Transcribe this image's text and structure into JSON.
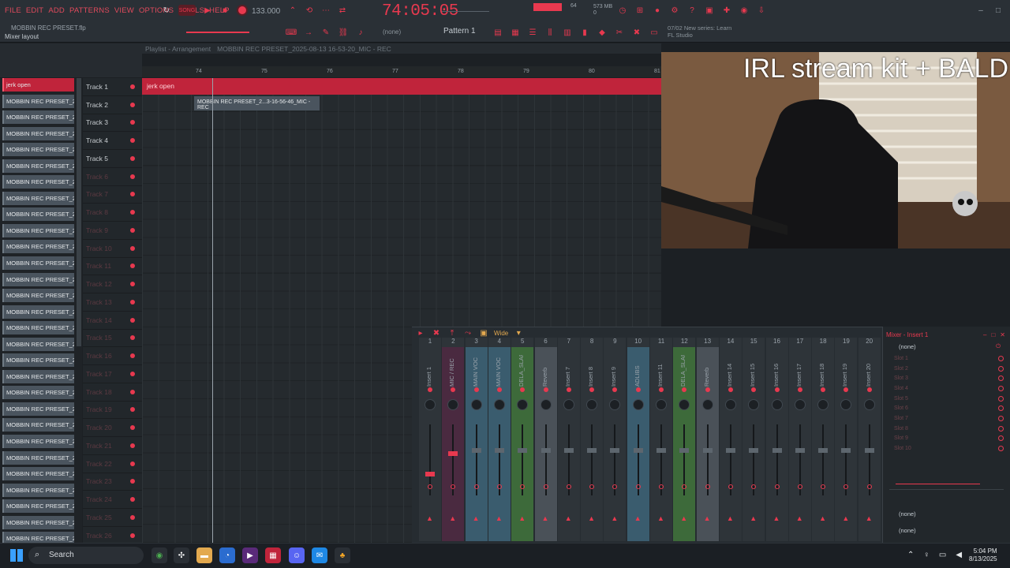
{
  "menu": [
    "FILE",
    "EDIT",
    "ADD",
    "PATTERNS",
    "VIEW",
    "OPTIONS",
    "TOOLS",
    "HELP"
  ],
  "transport": {
    "mode": "SONG",
    "tempo": "133.000",
    "time": "74:05:05",
    "meter_value": "64",
    "memory": "573 MB",
    "memory_sub": "0"
  },
  "project": {
    "file": "MOBBIN REC PRESET.flp",
    "hint": "Mixer layout",
    "pattern": "Pattern 1",
    "none_label": "(none)"
  },
  "news": {
    "date": "07/02",
    "text": "New series: Learn",
    "brand": "FL Studio"
  },
  "playlist": {
    "title": "Playlist - Arrangement",
    "path": "MOBBIN REC PRESET_2025-08-13 16-53-20_MIC - REC",
    "ruler": [
      "74",
      "75",
      "76",
      "77",
      "78",
      "79",
      "80",
      "81"
    ],
    "top_clip": "jerk open",
    "second_clip": "MOBBIN REC PRESET_2...3-16-56-46_MIC - REC",
    "left_clips": [
      "jerk open",
      "MOBBIN REC PRESET_202...",
      "MOBBIN REC PRESET_202...",
      "MOBBIN REC PRESET_202...",
      "MOBBIN REC PRESET_202...",
      "MOBBIN REC PRESET_202...",
      "MOBBIN REC PRESET_202...",
      "MOBBIN REC PRESET_202...",
      "MOBBIN REC PRESET_202...",
      "MOBBIN REC PRESET_202...",
      "MOBBIN REC PRESET_202...",
      "MOBBIN REC PRESET_202...",
      "MOBBIN REC PRESET_202...",
      "MOBBIN REC PRESET_202...",
      "MOBBIN REC PRESET_202...",
      "MOBBIN REC PRESET_202...",
      "MOBBIN REC PRESET_202...",
      "MOBBIN REC PRESET_202...",
      "MOBBIN REC PRESET_202...",
      "MOBBIN REC PRESET_202...",
      "MOBBIN REC PRESET_202...",
      "MOBBIN REC PRESET_202...",
      "MOBBIN REC PRESET_202...",
      "MOBBIN REC PRESET_202...",
      "MOBBIN REC PRESET_202...",
      "MOBBIN REC PRESET_202...",
      "MOBBIN REC PRESET_202...",
      "MOBBIN REC PRESET_202...",
      "MOBBIN REC PRESET_202..."
    ],
    "tracks": [
      "Track 1",
      "Track 2",
      "Track 3",
      "Track 4",
      "Track 5",
      "Track 6",
      "Track 7",
      "Track 8",
      "Track 9",
      "Track 10",
      "Track 11",
      "Track 12",
      "Track 13",
      "Track 14",
      "Track 15",
      "Track 16",
      "Track 17",
      "Track 18",
      "Track 19",
      "Track 20",
      "Track 21",
      "Track 22",
      "Track 23",
      "Track 24",
      "Track 25",
      "Track 26"
    ]
  },
  "webcam": {
    "overlay": "IRL stream kit + BALD"
  },
  "mixer": {
    "layout": "Wide",
    "strips": [
      {
        "num": "1",
        "name": "Insert 1",
        "color": "#2e3439"
      },
      {
        "num": "2",
        "name": "MIC / REC",
        "color": "#4a2a40"
      },
      {
        "num": "3",
        "name": "MAIN VOC",
        "color": "#3a5c6e"
      },
      {
        "num": "4",
        "name": "MAIN VOC",
        "color": "#3a5c6e"
      },
      {
        "num": "5",
        "name": "DELA_SLAP",
        "color": "#3d6a3a"
      },
      {
        "num": "6",
        "name": "Reverb",
        "color": "#4a5158"
      },
      {
        "num": "7",
        "name": "Insert 7",
        "color": "#2e3439"
      },
      {
        "num": "8",
        "name": "Insert 8",
        "color": "#2e3439"
      },
      {
        "num": "9",
        "name": "Insert 9",
        "color": "#2e3439"
      },
      {
        "num": "10",
        "name": "ADLIBS",
        "color": "#3a5c6e"
      },
      {
        "num": "11",
        "name": "Insert 11",
        "color": "#2e3439"
      },
      {
        "num": "12",
        "name": "DELA_SLAP",
        "color": "#3d6a3a"
      },
      {
        "num": "13",
        "name": "Reverb",
        "color": "#4a5158"
      },
      {
        "num": "14",
        "name": "Insert 14",
        "color": "#2e3439"
      },
      {
        "num": "15",
        "name": "Insert 15",
        "color": "#2e3439"
      },
      {
        "num": "16",
        "name": "Insert 16",
        "color": "#2e3439"
      },
      {
        "num": "17",
        "name": "Insert 17",
        "color": "#2e3439"
      },
      {
        "num": "18",
        "name": "Insert 18",
        "color": "#2e3439"
      },
      {
        "num": "19",
        "name": "Insert 19",
        "color": "#2e3439"
      },
      {
        "num": "20",
        "name": "Insert 20",
        "color": "#2e3439"
      }
    ],
    "insert": {
      "title": "Mixer - Insert 1",
      "preset": "(none)",
      "slots": [
        "Slot 1",
        "Slot 2",
        "Slot 3",
        "Slot 4",
        "Slot 5",
        "Slot 6",
        "Slot 7",
        "Slot 8",
        "Slot 9",
        "Slot 10"
      ],
      "send_none": "(none)",
      "out_none": "(none)"
    }
  },
  "taskbar": {
    "search": "Search",
    "time": "5:04 PM",
    "date": "8/13/2025"
  },
  "colors": {
    "accent": "#e8394f",
    "bg": "#1c2024"
  }
}
